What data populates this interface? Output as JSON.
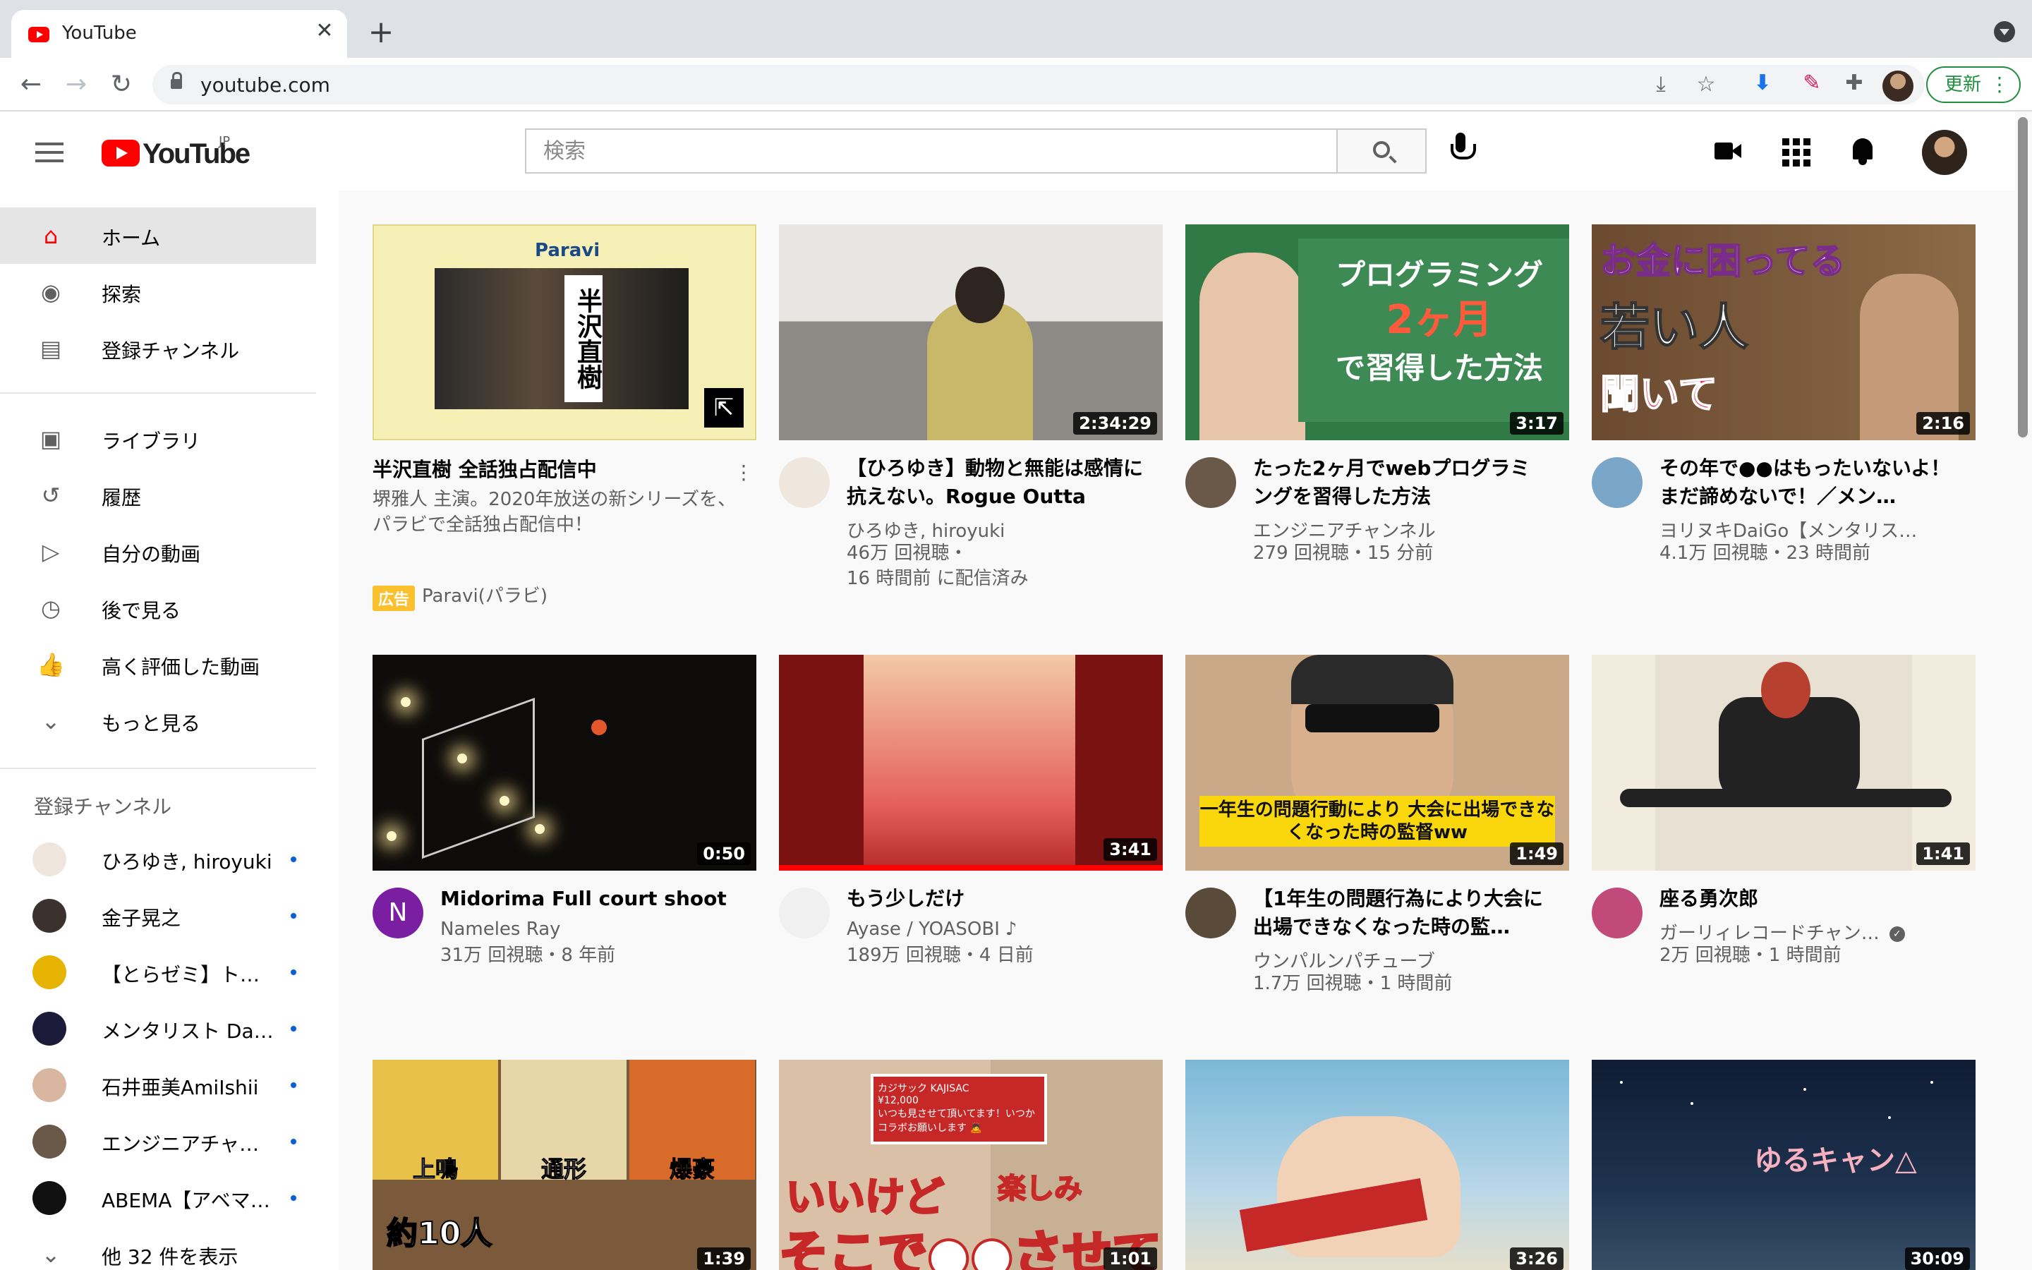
{
  "browser": {
    "tab_title": "YouTube",
    "tab_close": "✕",
    "new_tab": "+",
    "url": "youtube.com",
    "update_label": "更新",
    "back": "←",
    "forward": "→",
    "reload": "↻"
  },
  "header": {
    "logo_text": "YouTube",
    "region": "JP",
    "search_placeholder": "検索"
  },
  "sidebar": {
    "main_items": [
      {
        "label": "ホーム",
        "icon": "home-icon",
        "glyph": "⌂",
        "active": true
      },
      {
        "label": "探索",
        "icon": "compass-icon",
        "glyph": "◉"
      },
      {
        "label": "登録チャンネル",
        "icon": "subscriptions-icon",
        "glyph": "▤"
      }
    ],
    "library_items": [
      {
        "label": "ライブラリ",
        "icon": "library-icon",
        "glyph": "▣"
      },
      {
        "label": "履歴",
        "icon": "history-icon",
        "glyph": "↺"
      },
      {
        "label": "自分の動画",
        "icon": "my-videos-icon",
        "glyph": "▷"
      },
      {
        "label": "後で見る",
        "icon": "watch-later-icon",
        "glyph": "◷"
      },
      {
        "label": "高く評価した動画",
        "icon": "liked-icon",
        "glyph": "👍"
      },
      {
        "label": "もっと見る",
        "icon": "chevron-down-icon",
        "glyph": "⌄"
      }
    ],
    "subscriptions_heading": "登録チャンネル",
    "subscriptions": [
      {
        "label": "ひろゆき, hiroyuki",
        "color": "#efe6dd"
      },
      {
        "label": "金子晃之",
        "color": "#3b3230"
      },
      {
        "label": "【とらゼミ】トラ…",
        "color": "#e6b400"
      },
      {
        "label": "メンタリスト DaiGo",
        "color": "#1c1c3a"
      },
      {
        "label": "石井亜美AmiIshii",
        "color": "#d9b6a0"
      },
      {
        "label": "エンジニアチャン…",
        "color": "#6a5848"
      },
      {
        "label": "ABEMA【アベマ】…",
        "color": "#111111"
      }
    ],
    "show_more": "他 32 件を表示"
  },
  "videos": [
    {
      "kind": "ad",
      "title": "半沢直樹 全話独占配信中",
      "desc": "堺雅人 主演。2020年放送の新シリーズを、パラビで全話独占配信中！",
      "badge": "広告",
      "channel": "Paravi(パラビ)",
      "thumb_brand": "Paravi",
      "thumb_kanji": "半沢直樹"
    },
    {
      "title": "【ひろゆき】動物と無能は感情に抗えない。Rogue Outta Lin…",
      "channel": "ひろゆき, hiroyuki",
      "stats": "46万 回視聴・",
      "stats2": "16 時間前 に配信済み",
      "duration": "2:34:29",
      "avatar_color": "#efe6dd"
    },
    {
      "title": "たった2ヶ月でwebプログラミングを習得した方法",
      "channel": "エンジニアチャンネル",
      "stats": "279 回視聴・15 分前",
      "duration": "3:17",
      "avatar_color": "#6a5848",
      "thumb_line1": "プログラミング",
      "thumb_line2": "2ヶ月",
      "thumb_line3": "で習得した方法"
    },
    {
      "title": "その年で●●はもったいないよ！まだ諦めないで！／メン…",
      "channel": "ヨリヌキDaiGo【メンタリス…",
      "stats": "4.1万 回視聴・23 時間前",
      "duration": "2:16",
      "avatar_color": "#7aa6c9",
      "thumb_line1": "お金に困ってる",
      "thumb_line2": "若い人",
      "thumb_line3": "聞いて"
    },
    {
      "title": "Midorima Full court shoot",
      "channel": "Nameles Ray",
      "stats": "31万 回視聴・8 年前",
      "duration": "0:50",
      "avatar_letter": "N",
      "avatar_color": "#7b1fa2"
    },
    {
      "title": "もう少しだけ",
      "channel": "Ayase / YOASOBI",
      "stats": "189万 回視聴・4 日前",
      "duration": "3:41",
      "avatar_color": "#f0f0f0",
      "music_note": "♪"
    },
    {
      "title": "【1年生の問題行為により大会に出場できなくなった時の監…",
      "channel": "ウンパルンパチューブ",
      "stats": "1.7万 回視聴・1 時間前",
      "duration": "1:49",
      "avatar_color": "#5a4a3a",
      "thumb_caption": "一年生の問題行動により 大会に出場できなくなった時の監督ww"
    },
    {
      "title": "座る勇次郎",
      "channel": "ガーリィレコードチャン…",
      "stats": "2万 回視聴・1 時間前",
      "duration": "1:41",
      "avatar_color": "#c24a7a",
      "verified": "✓"
    },
    {
      "duration": "1:39",
      "thumb_labels": [
        "上鳴",
        "通形",
        "爆豪"
      ],
      "thumb_big": "約10人"
    },
    {
      "duration": "1:01",
      "thumb_msg_name": "カジサック KAJISAC",
      "thumb_msg_amount": "¥12,000",
      "thumb_msg_text": "いつも見させて頂いてます！いつかコラボお願いします 🙇",
      "thumb_line1": "いいけど",
      "thumb_line2": "そこで●●させて",
      "thumb_line3": "楽しみ"
    },
    {
      "duration": "3:26"
    },
    {
      "duration": "30:09",
      "thumb_logo": "ゆるキャン△"
    }
  ]
}
